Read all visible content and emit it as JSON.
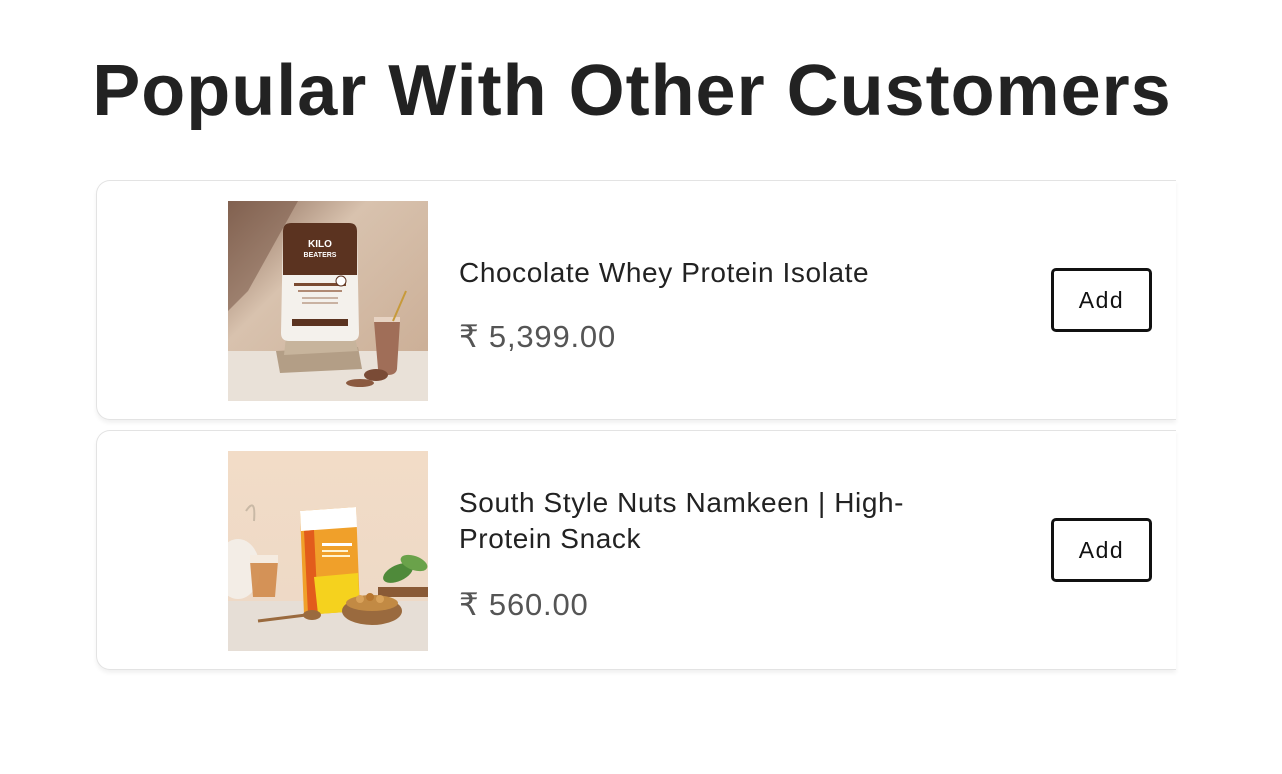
{
  "section": {
    "title": "Popular With Other Customers"
  },
  "products": [
    {
      "name": "Chocolate Whey Protein Isolate",
      "price": "₹ 5,399.00",
      "add_label": "Add",
      "image_alt": "Chocolate Whey Protein Isolate pouch",
      "package_brand_text": "KILO BEATERS"
    },
    {
      "name": "South Style Nuts Namkeen | High-Protein Snack",
      "price": "₹ 560.00",
      "add_label": "Add",
      "image_alt": "South Style Nuts Namkeen pouch"
    }
  ],
  "colors": {
    "text": "#222222",
    "price": "#555555",
    "button_border": "#111111",
    "card_border": "#e3e3e3"
  }
}
